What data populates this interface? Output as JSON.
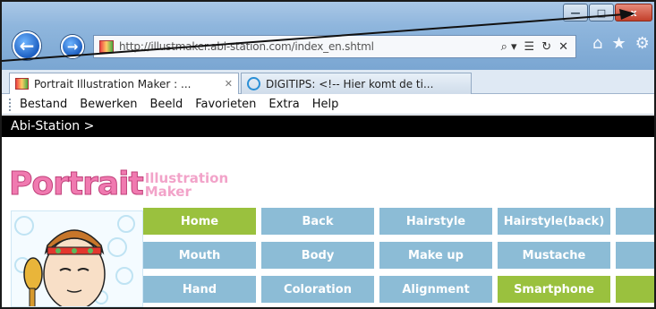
{
  "window": {
    "minimize_glyph": "—",
    "maximize_glyph": "□",
    "close_glyph": "x"
  },
  "nav": {
    "back_glyph": "←",
    "forward_glyph": "→",
    "url": "http://illustmaker.abi-station.com/index_en.shtml",
    "search_glyph": "⌕ ▾",
    "compat_glyph": "☰",
    "refresh_glyph": "↻",
    "stop_glyph": "✕",
    "home_glyph": "⌂",
    "favorites_glyph": "★",
    "tools_glyph": "⚙"
  },
  "tabs": [
    {
      "label": "Portrait Illustration Maker : ...",
      "close": "✕"
    },
    {
      "label": "DIGITIPS: <!-- Hier komt de ti..."
    }
  ],
  "menu": [
    "Bestand",
    "Bewerken",
    "Beeld",
    "Favorieten",
    "Extra",
    "Help"
  ],
  "page": {
    "header": "Abi-Station >",
    "logo_main": "Portrait",
    "logo_sub_1": "Illustration",
    "logo_sub_2": "Maker"
  },
  "buttons": [
    {
      "label": "Home",
      "color": "#9ac13e"
    },
    {
      "label": "Back",
      "color": "#8cbcd6"
    },
    {
      "label": "Hairstyle",
      "color": "#8cbcd6"
    },
    {
      "label": "Hairstyle(back)",
      "color": "#8cbcd6"
    },
    {
      "label": "Fa",
      "color": "#8cbcd6"
    },
    {
      "label": "Mouth",
      "color": "#8cbcd6"
    },
    {
      "label": "Body",
      "color": "#8cbcd6"
    },
    {
      "label": "Make up",
      "color": "#8cbcd6"
    },
    {
      "label": "Mustache",
      "color": "#8cbcd6"
    },
    {
      "label": "G",
      "color": "#8cbcd6"
    },
    {
      "label": "Hand",
      "color": "#8cbcd6"
    },
    {
      "label": "Coloration",
      "color": "#8cbcd6"
    },
    {
      "label": "Alignment",
      "color": "#8cbcd6"
    },
    {
      "label": "Smartphone",
      "color": "#9ac13e"
    },
    {
      "label": "Pe",
      "color": "#9ac13e"
    }
  ]
}
